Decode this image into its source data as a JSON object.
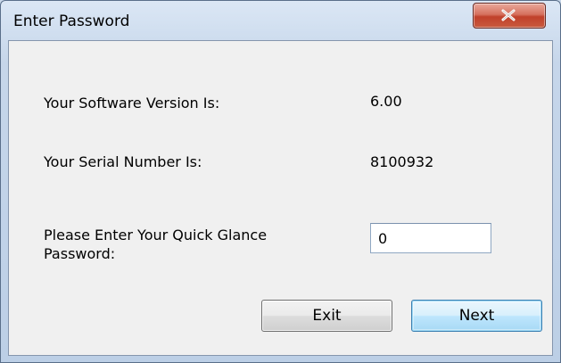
{
  "window": {
    "title": "Enter Password",
    "close_icon": "close-x-icon"
  },
  "info": {
    "version_label": "Your Software Version Is:",
    "version_value": "6.00",
    "serial_label": "Your Serial Number Is:",
    "serial_value": "8100932"
  },
  "password": {
    "label_line1": "Please Enter Your Quick Glance",
    "label_line2": "Password:",
    "value": "0"
  },
  "buttons": {
    "exit_label": "Exit",
    "next_label": "Next"
  },
  "colors": {
    "close_button": "#c95a3e",
    "default_button_border": "#3c7fb1",
    "client_background": "#f0f0f0"
  }
}
